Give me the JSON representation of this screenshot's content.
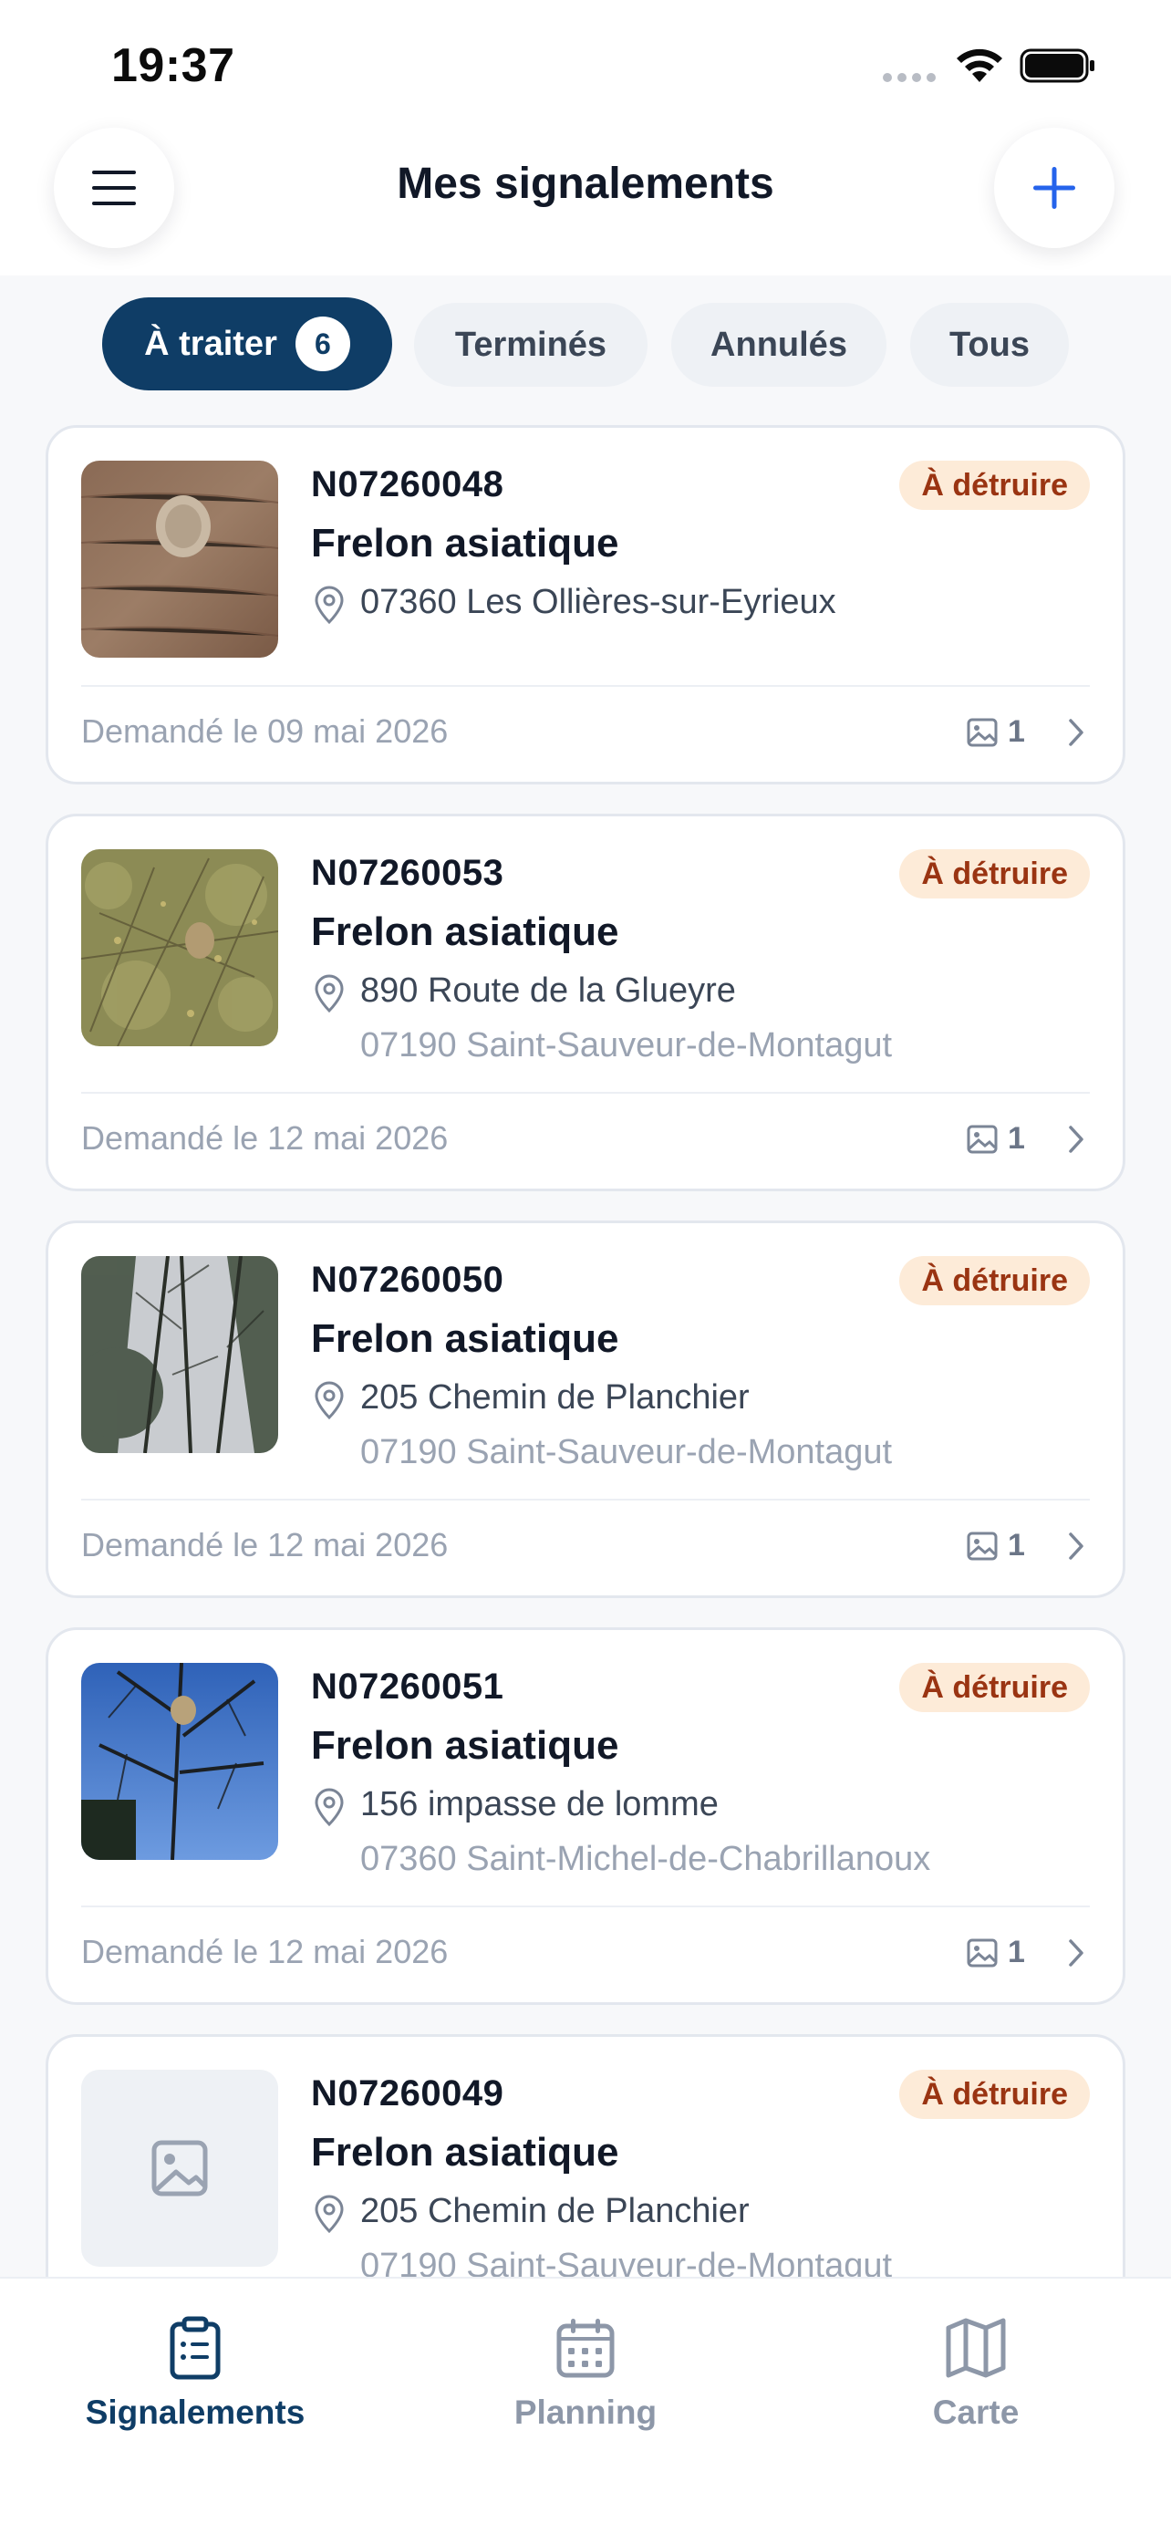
{
  "status_bar": {
    "time": "19:37"
  },
  "header": {
    "title": "Mes signalements",
    "menu_icon": "hamburger-menu-icon",
    "add_icon": "plus-icon"
  },
  "filters": [
    {
      "label": "À traiter",
      "count": "6",
      "active": true
    },
    {
      "label": "Terminés",
      "active": false
    },
    {
      "label": "Annulés",
      "active": false
    },
    {
      "label": "Tous",
      "active": false
    }
  ],
  "reports": [
    {
      "reference": "N07260048",
      "status": "À détruire",
      "species": "Frelon asiatique",
      "address_line1": "07360 Les Ollières-sur-Eyrieux",
      "address_line2": "",
      "requested": "Demandé le 09 mai 2026",
      "photo_count": "1",
      "thumbnail": "wood-nest-photo"
    },
    {
      "reference": "N07260053",
      "status": "À détruire",
      "species": "Frelon asiatique",
      "address_line1": "890 Route de la Glueyre",
      "address_line2": "07190 Saint-Sauveur-de-Montagut",
      "requested": "Demandé le 12 mai 2026",
      "photo_count": "1",
      "thumbnail": "bush-nest-photo"
    },
    {
      "reference": "N07260050",
      "status": "À détruire",
      "species": "Frelon asiatique",
      "address_line1": "205 Chemin de Planchier",
      "address_line2": "07190 Saint-Sauveur-de-Montagut",
      "requested": "Demandé le 12 mai 2026",
      "photo_count": "1",
      "thumbnail": "trees-photo"
    },
    {
      "reference": "N07260051",
      "status": "À détruire",
      "species": "Frelon asiatique",
      "address_line1": "156 impasse de lomme",
      "address_line2": "07360 Saint-Michel-de-Chabrillanoux",
      "requested": "Demandé le 12 mai 2026",
      "photo_count": "1",
      "thumbnail": "sky-tree-photo"
    },
    {
      "reference": "N07260049",
      "status": "À détruire",
      "species": "Frelon asiatique",
      "address_line1": "205 Chemin de Planchier",
      "address_line2": "07190 Saint-Sauveur-de-Montagut",
      "thumbnail": "image-placeholder-icon"
    }
  ],
  "tabbar": [
    {
      "label": "Signalements",
      "icon": "clipboard-list-icon",
      "active": true
    },
    {
      "label": "Planning",
      "icon": "calendar-icon",
      "active": false
    },
    {
      "label": "Carte",
      "icon": "map-icon",
      "active": false
    }
  ],
  "colors": {
    "primary": "#0f3d66",
    "accent": "#2563eb",
    "badge_bg": "#fdebd8",
    "badge_text": "#9a3412"
  }
}
